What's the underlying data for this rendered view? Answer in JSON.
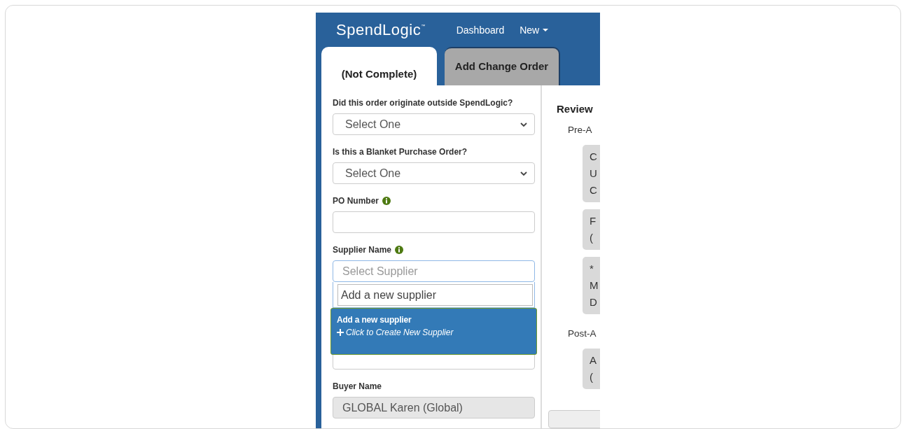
{
  "header": {
    "logo": "SpendLogic",
    "logo_mark": "™",
    "nav": [
      {
        "label": "Dashboard",
        "kind": "link"
      },
      {
        "label": "New",
        "kind": "dropdown"
      }
    ]
  },
  "tabs": [
    {
      "label": "(Not Complete)",
      "selected": true
    },
    {
      "label": "Add Change Order",
      "selected": false
    }
  ],
  "form": {
    "fields": [
      {
        "kind": "select",
        "label": "Did this order originate outside SpendLogic?",
        "value": "Select One"
      },
      {
        "kind": "select",
        "label": "Is this a Blanket Purchase Order?",
        "value": "Select One"
      },
      {
        "kind": "text",
        "label": "PO Number",
        "info": true
      },
      {
        "kind": "combo",
        "label": "Supplier Name",
        "info": true,
        "placeholder": "Select Supplier",
        "search": "Add a new supplier",
        "option": {
          "title": "Add a new supplier",
          "action": "Click to Create New Supplier",
          "selected": true
        }
      },
      {
        "kind": "text"
      },
      {
        "kind": "readonly",
        "label": "Buyer Name",
        "value": "GLOBAL Karen (Global)"
      }
    ]
  },
  "review": {
    "title": "Review",
    "sections": [
      {
        "label": "Pre-A",
        "cards": [
          [
            "C",
            "U",
            "C"
          ],
          [
            "F",
            "("
          ],
          [
            "*",
            "M",
            "D"
          ]
        ]
      },
      {
        "label": "Post-A",
        "cards": [
          [
            "A",
            "("
          ]
        ]
      }
    ]
  }
}
